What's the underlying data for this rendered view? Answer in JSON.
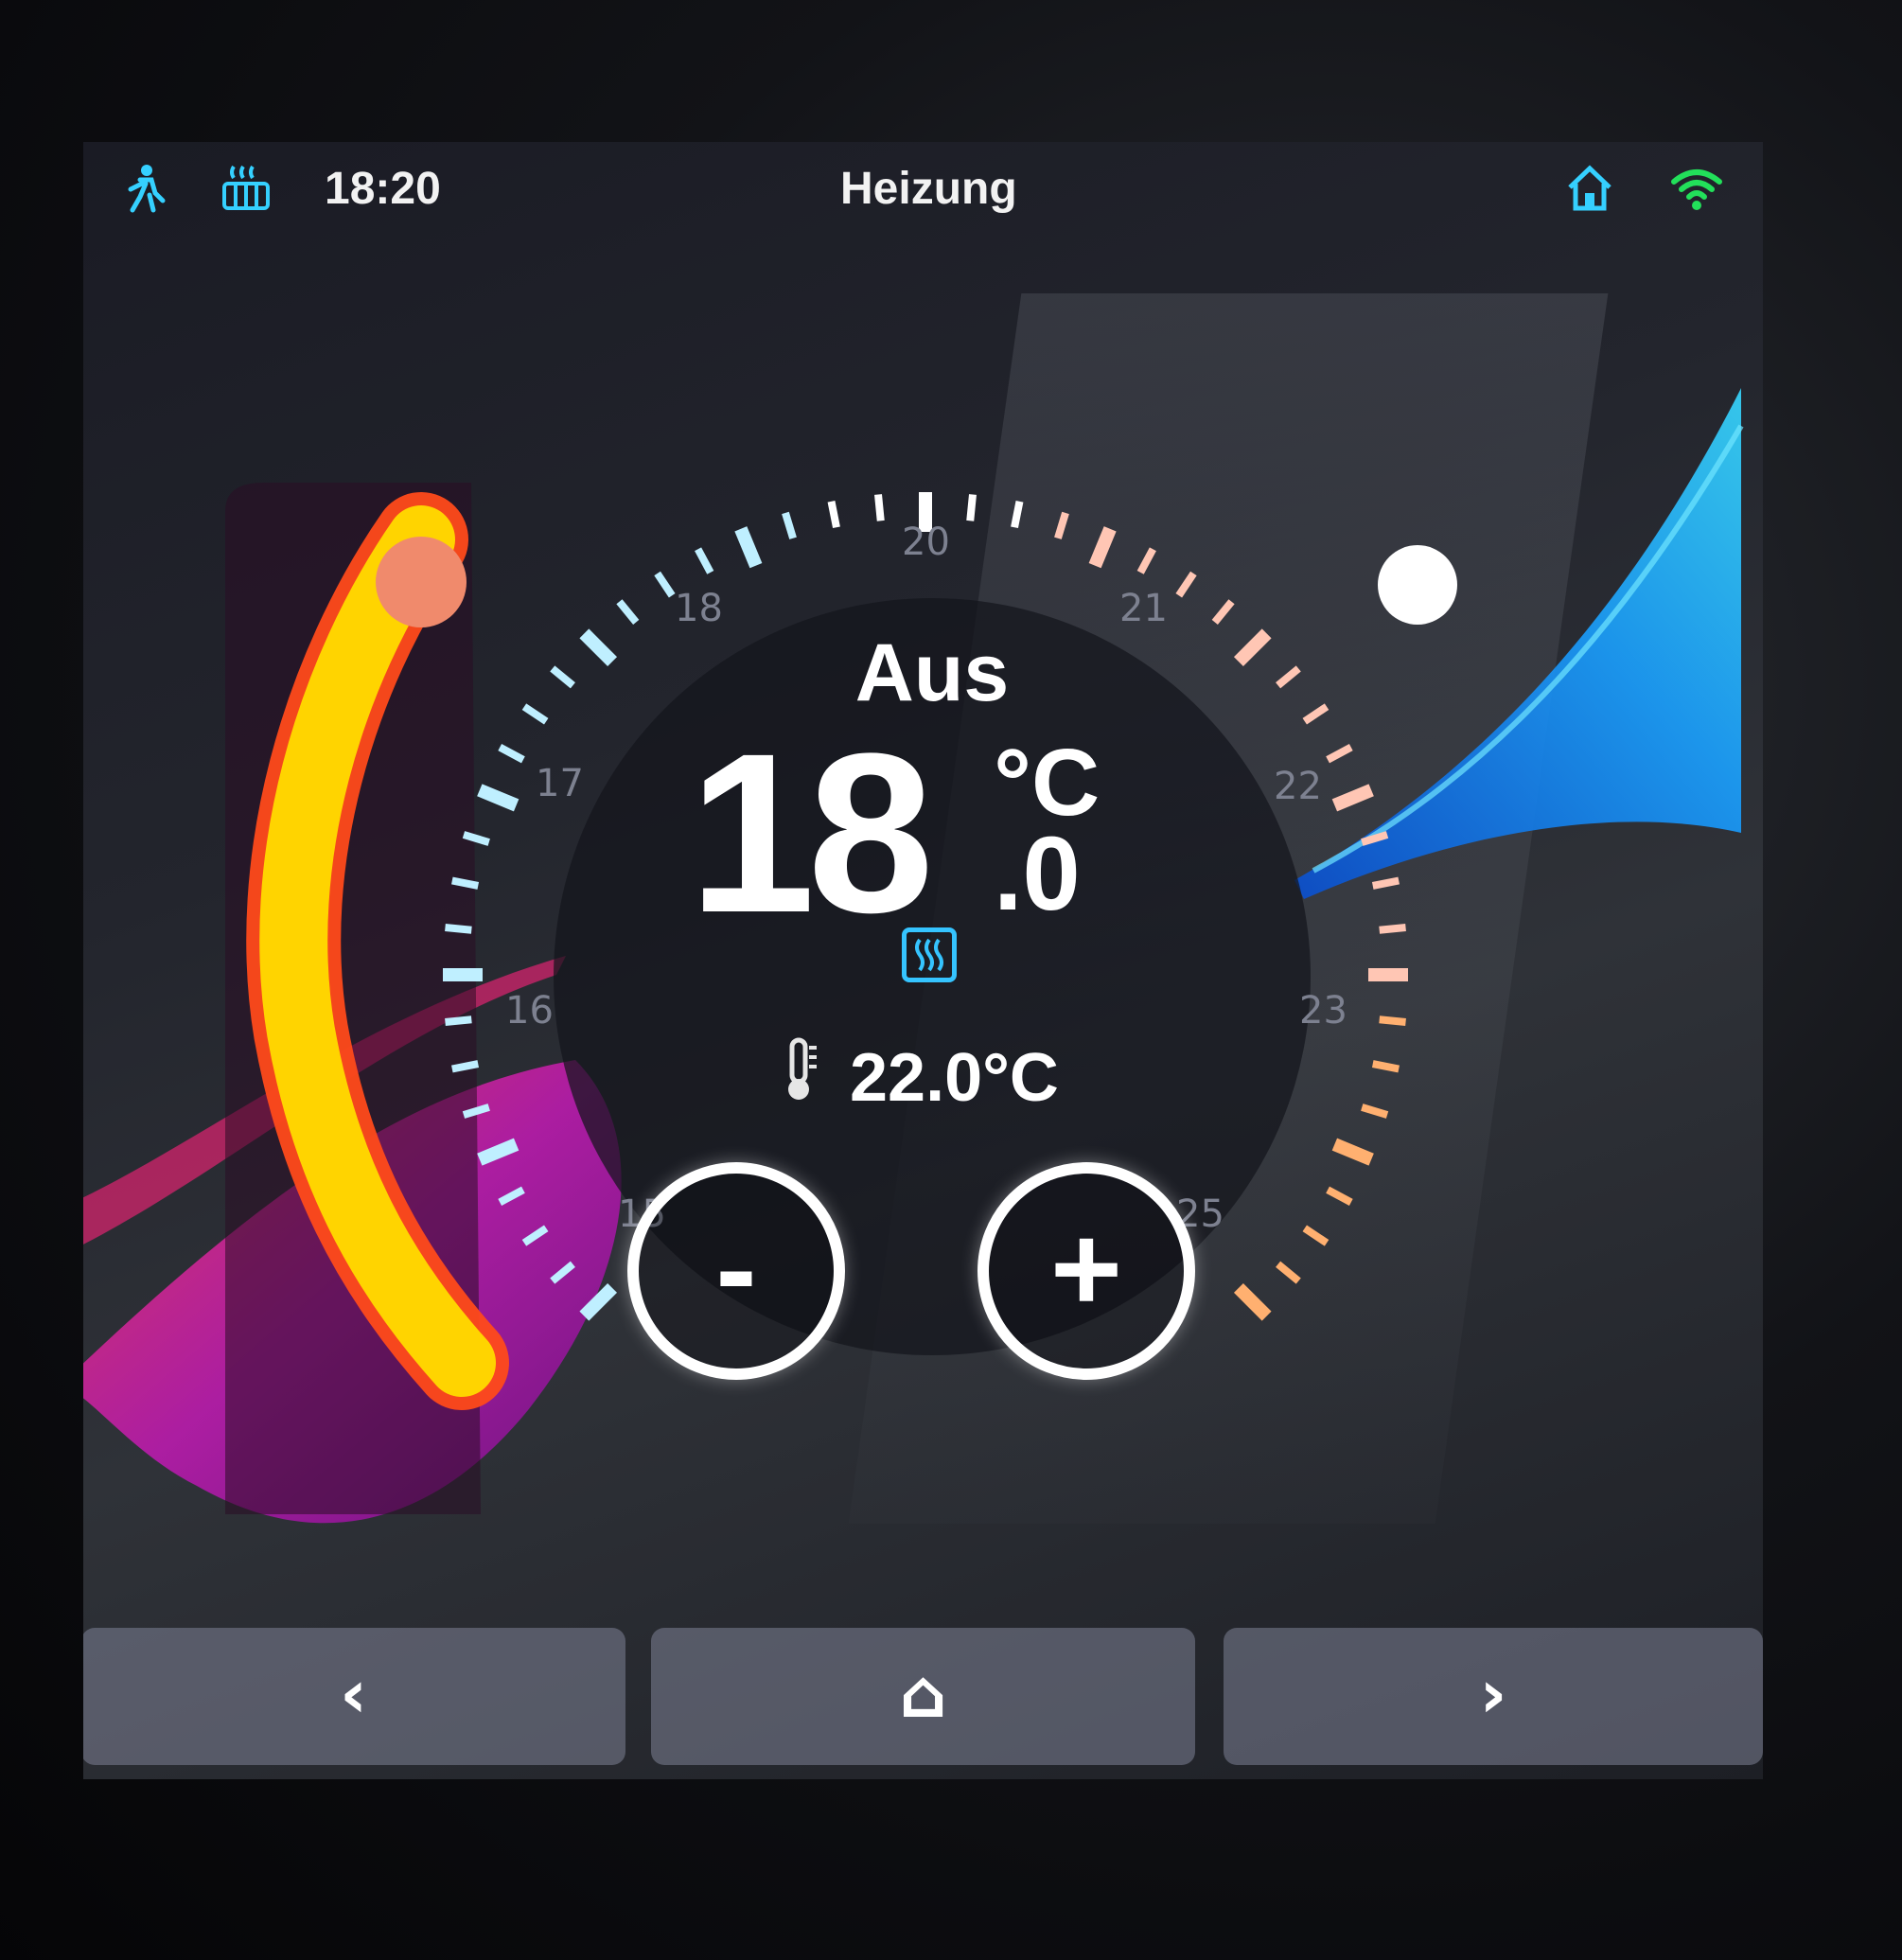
{
  "status_bar": {
    "presence_icon": "person-motion-icon",
    "heating_icon": "radiator-icon",
    "time": "18:20",
    "title": "Heizung",
    "home_icon": "home-icon",
    "wifi_icon": "wifi-icon"
  },
  "thermostat": {
    "mode": "Aus",
    "setpoint_integer": "18",
    "setpoint_decimal": ".0",
    "setpoint_unit": "°C",
    "actual_temperature": "22.0°C",
    "scale_labels": [
      "15",
      "16",
      "17",
      "18",
      "20",
      "21",
      "22",
      "23",
      "25"
    ]
  },
  "controls": {
    "minus_label": "-",
    "plus_label": "+"
  },
  "nav": {
    "back_label": "‹",
    "home_label": "⌂",
    "forward_label": "›"
  },
  "colors": {
    "accent_blue": "#35c4ff",
    "wifi_green": "#22e05a",
    "arc_yellow": "#ffd400",
    "arc_red": "#ff4a1a",
    "knob_salmon": "#f08a6c"
  }
}
